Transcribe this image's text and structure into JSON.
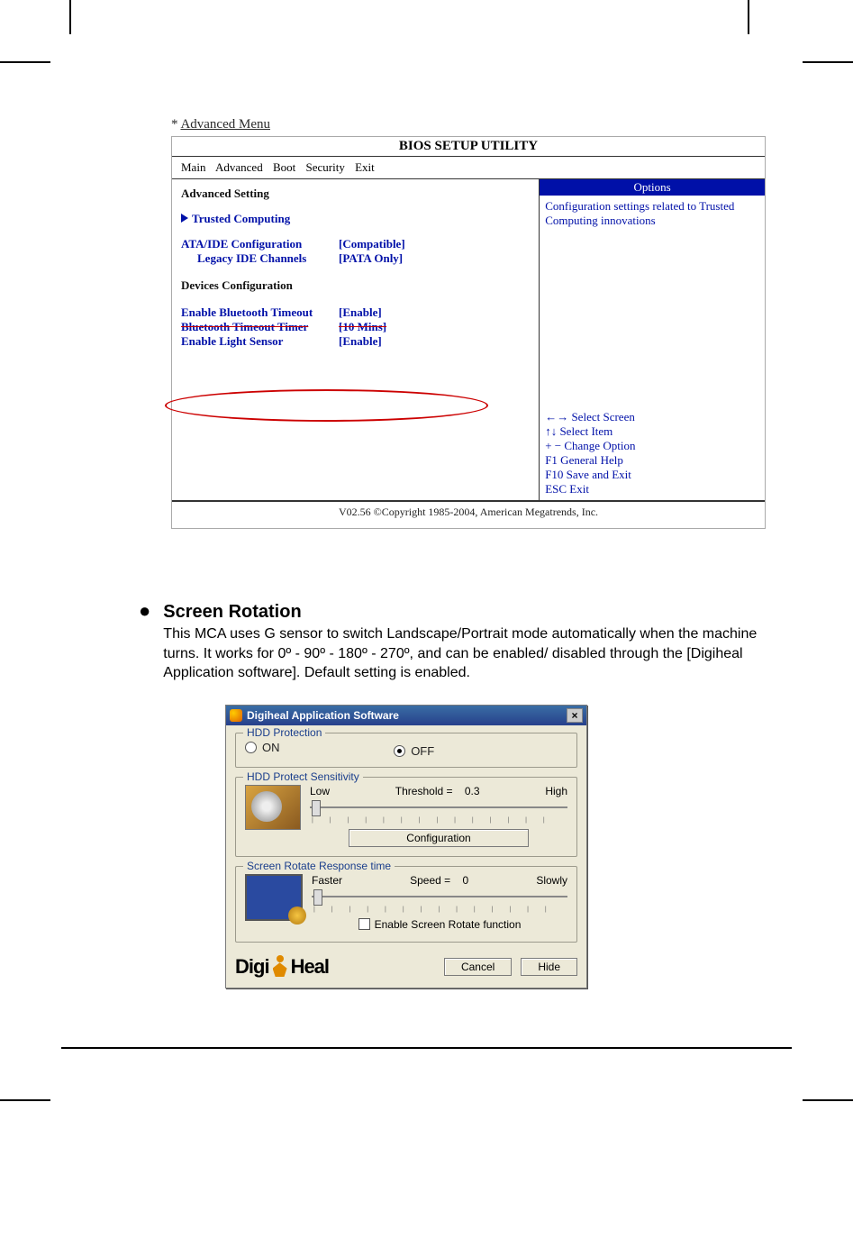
{
  "bios": {
    "section_label_prefix": "* ",
    "section_label": "Advanced Menu",
    "title": "BIOS SETUP UTILITY",
    "tabs": [
      "Main",
      "Advanced",
      "Boot",
      "Security",
      "Exit"
    ],
    "left": {
      "heading": "Advanced Setting",
      "trusted": "Trusted Computing",
      "ata_label": "ATA/IDE Configuration",
      "ata_value": "[Compatible]",
      "legacy_label": "Legacy IDE Channels",
      "legacy_value": "[PATA Only]",
      "devcfg": "Devices Configuration",
      "bt_timeout_label": "Enable Bluetooth Timeout",
      "bt_timeout_value": "[Enable]",
      "bt_timer_label": "Bluetooth Timeout Timer",
      "bt_timer_value": "[10 Mins]",
      "light_label": "Enable Light Sensor",
      "light_value": "[Enable]"
    },
    "right": {
      "options_header": "Options",
      "options_text": "Configuration settings related to Trusted Computing innovations",
      "help": [
        "←→ Select Screen",
        "↑↓ Select Item",
        "+ −   Change Option",
        "F1  General Help",
        "F10 Save and Exit",
        "ESC Exit"
      ]
    },
    "footer": "V02.56  ©Copyright 1985-2004, American Megatrends, Inc."
  },
  "section": {
    "bullet": "●",
    "title": "Screen Rotation",
    "body": "This MCA uses G sensor to switch Landscape/Portrait mode automatically when the machine turns. It works for 0º - 90º - 180º - 270º, and can be enabled/ disabled through the [Digiheal Application software]. Default setting is enabled."
  },
  "dialog": {
    "title": "Digiheal Application Software",
    "close": "×",
    "hdd_protection": {
      "legend": "HDD Protection",
      "on": "ON",
      "off": "OFF",
      "selected": "off"
    },
    "sensitivity": {
      "legend": "HDD Protect Sensitivity",
      "low": "Low",
      "high": "High",
      "threshold_label": "Threshold =",
      "threshold_value": "0.3",
      "config_btn": "Configuration"
    },
    "rotate": {
      "legend": "Screen Rotate Response time",
      "faster": "Faster",
      "slowly": "Slowly",
      "speed_label": "Speed =",
      "speed_value": "0",
      "enable_label": "Enable Screen Rotate function"
    },
    "logo_a": "Digi",
    "logo_b": "Heal",
    "cancel": "Cancel",
    "hide": "Hide"
  }
}
